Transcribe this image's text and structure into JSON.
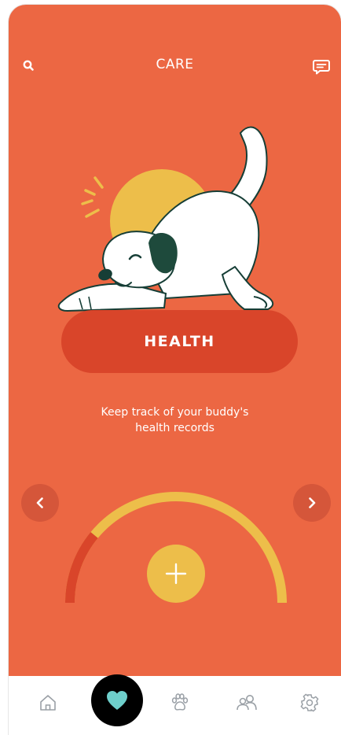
{
  "header": {
    "title": "CARE",
    "left_icon": "search-icon",
    "right_icon": "chat-icon"
  },
  "feature": {
    "label": "HEALTH",
    "description_line1": "Keep track of your buddy's",
    "description_line2": "health records"
  },
  "carousel": {
    "prev_icon": "chevron-left-icon",
    "next_icon": "chevron-right-icon"
  },
  "gauge": {
    "progress_fraction": 0.22,
    "action_icon": "plus-icon"
  },
  "navbar": {
    "items": [
      {
        "icon": "home-icon"
      },
      {
        "icon": "heart-icon",
        "active": true
      },
      {
        "icon": "paw-icon"
      },
      {
        "icon": "people-icon"
      },
      {
        "icon": "gear-icon"
      }
    ]
  },
  "colors": {
    "background": "#EC6743",
    "pill": "#D9452A",
    "accent_yellow": "#EDBE4A",
    "accent_red": "#D9452A",
    "active_heart": "#6ECFCB"
  }
}
